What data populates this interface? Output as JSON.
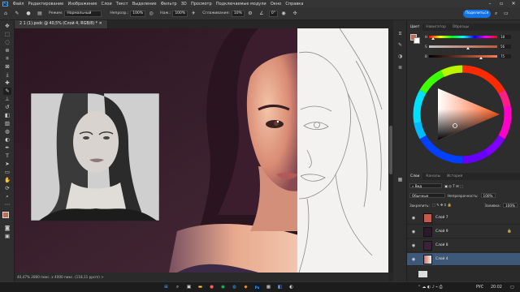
{
  "menu": [
    "Файл",
    "Редактирование",
    "Изображение",
    "Слои",
    "Текст",
    "Выделение",
    "Фильтр",
    "3D",
    "Просмотр",
    "Подключаемые модули",
    "Окно",
    "Справка"
  ],
  "app_logo": "Ps",
  "options": {
    "mode_label": "Режим:",
    "mode_value": "Нормальный",
    "opacity_label": "Непрозр.:",
    "opacity_value": "100%",
    "flow_label": "Наж.:",
    "flow_value": "100%",
    "smoothing_label": "Сглаживание:",
    "smoothing_value": "10%",
    "angle_value": "0°",
    "share_label": "Поделиться"
  },
  "document_tab": "2 1 (1).psdc @ 40,5% (Слой 4, RGB/8) *",
  "status_text": "40,47%   2800 пикс. x 4000 пикс. (118,11 ppcm)   >",
  "color_panel": {
    "tabs": [
      "Цвет",
      "Навигатор",
      "Образцы"
    ],
    "sliders": [
      {
        "label": "H",
        "value": "18"
      },
      {
        "label": "S",
        "value": "56"
      },
      {
        "label": "B",
        "value": "75"
      }
    ],
    "colors": {
      "foreground": "#bf6a54",
      "background": "#ffffff",
      "accent": "#1473e6"
    }
  },
  "layers_panel": {
    "tabs": [
      "Слои",
      "Каналы",
      "История"
    ],
    "filter_label": "Вид",
    "blend_mode": "Обычные",
    "opacity_label": "Непрозрачность:",
    "opacity_value": "100%",
    "lock_label": "Закрепить:",
    "fill_label": "Заливка:",
    "fill_value": "100%",
    "layers": [
      {
        "name": "Слой 7",
        "selected": false
      },
      {
        "name": "Слой 9",
        "selected": false
      },
      {
        "name": "Слой 8",
        "selected": false
      },
      {
        "name": "Слой 4",
        "selected": true
      }
    ]
  },
  "tray": {
    "language": "РУС",
    "time": "20:02"
  }
}
